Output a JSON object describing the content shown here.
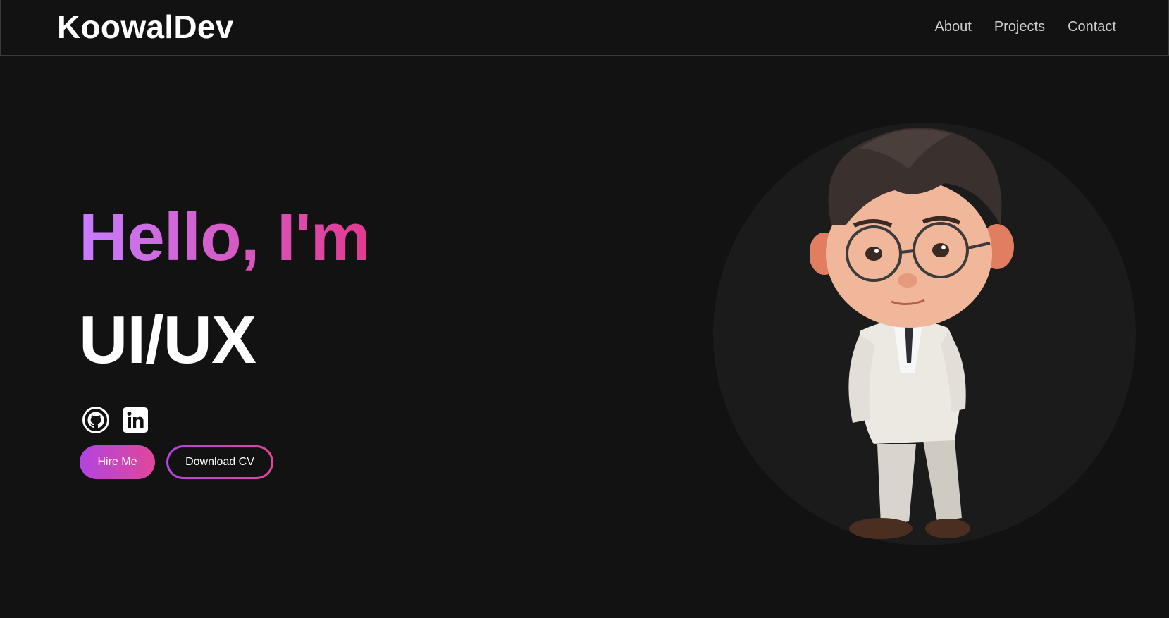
{
  "header": {
    "brand": "KoowalDev",
    "nav": [
      {
        "label": "About"
      },
      {
        "label": "Projects"
      },
      {
        "label": "Contact"
      }
    ]
  },
  "hero": {
    "greeting": "Hello, I'm",
    "role": "UI/UX",
    "socials": [
      {
        "icon": "github-icon"
      },
      {
        "icon": "linkedin-icon"
      }
    ],
    "buttons": {
      "hire": "Hire Me",
      "cv": "Download CV"
    }
  },
  "colors": {
    "background": "#121212",
    "accent_start": "#c77dff",
    "accent_end": "#e23a8e"
  }
}
